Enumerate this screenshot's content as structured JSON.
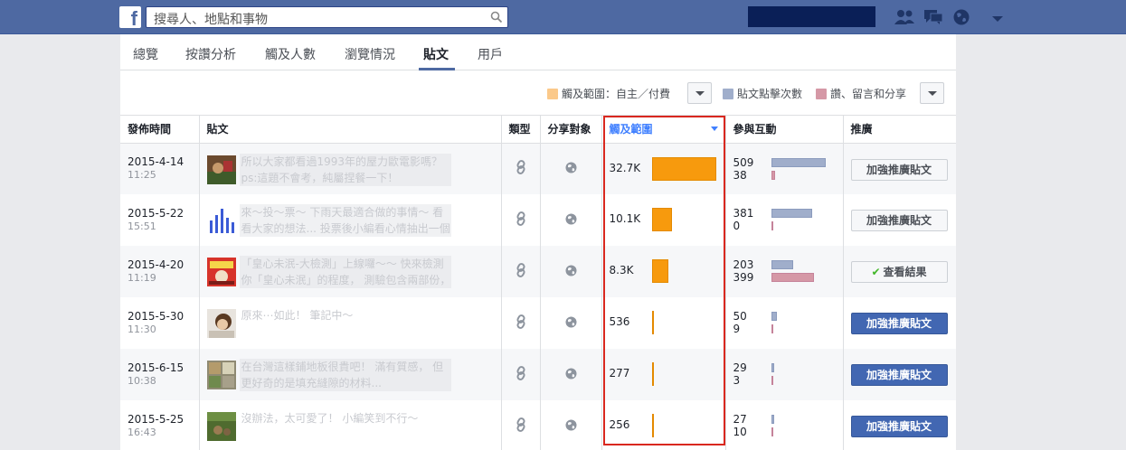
{
  "header": {
    "logo_text": "f",
    "search_placeholder": "搜尋人、地點和事物"
  },
  "tabs": [
    {
      "label": "總覽",
      "active": false
    },
    {
      "label": "按讚分析",
      "active": false
    },
    {
      "label": "觸及人數",
      "active": false
    },
    {
      "label": "瀏覽情況",
      "active": false
    },
    {
      "label": "貼文",
      "active": true
    },
    {
      "label": "用戶",
      "active": false
    }
  ],
  "legend": {
    "reach": "觸及範圍：自主／付費",
    "clicks": "貼文點擊次數",
    "engagement": "讚、留言和分享",
    "colors": {
      "reach": "#fbc98a",
      "clicks": "#a0aecb",
      "engagement": "#d598a6"
    }
  },
  "table": {
    "headers": {
      "time": "發佈時間",
      "post": "貼文",
      "type": "類型",
      "target": "分享對象",
      "reach": "觸及範圍",
      "engagement": "參與互動",
      "promote": "推廣"
    },
    "rows": [
      {
        "date": "2015-4-14",
        "time": "11:25",
        "text": "所以大家都看過1993年的屋力歐電影嗎？ ps:這題不會考，純屬捏餐一下！",
        "reach": "32.7K",
        "reach_value": 32700,
        "clicks": "509",
        "clicks_value": 509,
        "eng": "38",
        "eng_value": 38,
        "button": "加強推廣貼文",
        "button_style": "default"
      },
      {
        "date": "2015-5-22",
        "time": "15:51",
        "text": "來～投～票～ 下雨天最適合做的事情～ 看看大家的想法... 投票後小編看心情抽出一個網友 然",
        "reach": "10.1K",
        "reach_value": 10100,
        "clicks": "381",
        "clicks_value": 381,
        "eng": "0",
        "eng_value": 0,
        "button": "加強推廣貼文",
        "button_style": "default"
      },
      {
        "date": "2015-4-20",
        "time": "11:19",
        "text": "「皇心未泯-大檢測」上線囉～～ 快來檢測你「皇心未泯」的程度， 測驗包含兩部份， 包含",
        "reach": "8.3K",
        "reach_value": 8300,
        "clicks": "203",
        "clicks_value": 203,
        "eng": "399",
        "eng_value": 399,
        "button": "查看結果",
        "button_style": "result"
      },
      {
        "date": "2015-5-30",
        "time": "11:30",
        "text": "原來⋯如此！ 筆記中～",
        "reach": "536",
        "reach_value": 536,
        "clicks": "50",
        "clicks_value": 50,
        "eng": "9",
        "eng_value": 9,
        "button": "加強推廣貼文",
        "button_style": "primary"
      },
      {
        "date": "2015-6-15",
        "time": "10:38",
        "text": "在台灣這樣鋪地板很貴吧！ 滿有質感， 但更好奇的是填充縫隙的材料...",
        "reach": "277",
        "reach_value": 277,
        "clicks": "29",
        "clicks_value": 29,
        "eng": "3",
        "eng_value": 3,
        "button": "加強推廣貼文",
        "button_style": "primary"
      },
      {
        "date": "2015-5-25",
        "time": "16:43",
        "text": "沒辦法，太可愛了！ 小編笑到不行～",
        "reach": "256",
        "reach_value": 256,
        "clicks": "27",
        "clicks_value": 27,
        "eng": "10",
        "eng_value": 10,
        "button": "加強推廣貼文",
        "button_style": "primary"
      }
    ]
  }
}
